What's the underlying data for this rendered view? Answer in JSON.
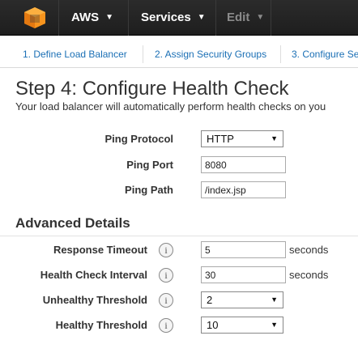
{
  "nav": {
    "brand": "AWS",
    "services": "Services",
    "edit": "Edit"
  },
  "tabs": [
    {
      "label": "1. Define Load Balancer"
    },
    {
      "label": "2. Assign Security Groups"
    },
    {
      "label": "3. Configure Se"
    }
  ],
  "page": {
    "title": "Step 4: Configure Health Check",
    "subtitle": "Your load balancer will automatically perform health checks on you"
  },
  "health_check": {
    "ping_protocol_label": "Ping Protocol",
    "ping_protocol_value": "HTTP",
    "ping_port_label": "Ping Port",
    "ping_port_value": "8080",
    "ping_path_label": "Ping Path",
    "ping_path_value": "/index.jsp"
  },
  "advanced": {
    "heading": "Advanced Details",
    "response_timeout_label": "Response Timeout",
    "response_timeout_value": "5",
    "response_timeout_unit": "seconds",
    "health_interval_label": "Health Check Interval",
    "health_interval_value": "30",
    "health_interval_unit": "seconds",
    "unhealthy_label": "Unhealthy Threshold",
    "unhealthy_value": "2",
    "healthy_label": "Healthy Threshold",
    "healthy_value": "10"
  },
  "icons": {
    "info_glyph": "i",
    "caret_glyph": "▼"
  },
  "colors": {
    "navbar": "#232323",
    "link": "#1a6fb5",
    "logo_orange": "#f90"
  }
}
